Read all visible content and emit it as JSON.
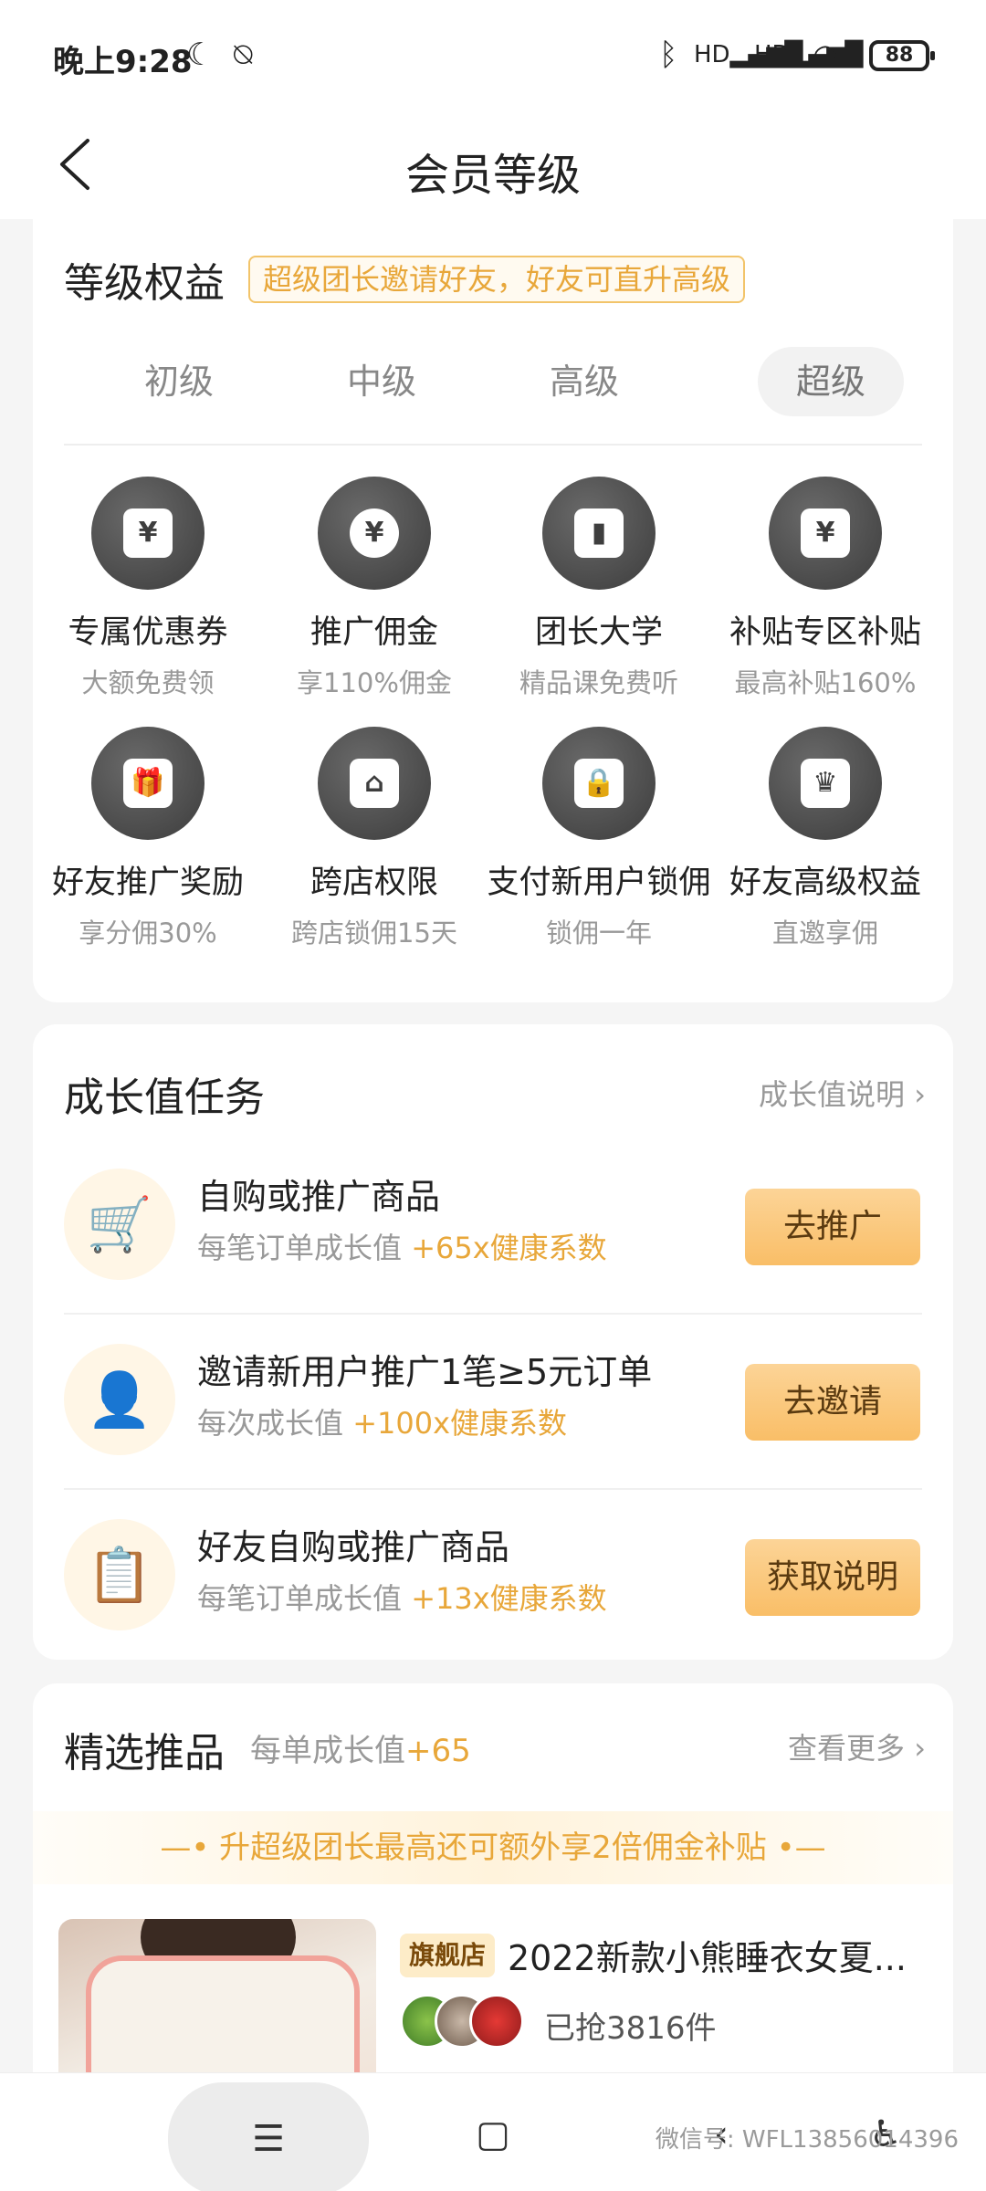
{
  "status_bar": {
    "time": "晚上9:28",
    "icons": [
      "moon-icon",
      "alarm-off-icon",
      "bluetooth-icon",
      "signal-hd-icon",
      "signal-hd-icon",
      "wifi-icon"
    ],
    "battery": "88"
  },
  "header": {
    "title": "会员等级",
    "back_icon": "chevron-left-icon"
  },
  "benefits_section": {
    "title": "等级权益",
    "promo": "超级团长邀请好友，好友可直升高级",
    "levels": [
      {
        "label": "初级",
        "active": false
      },
      {
        "label": "中级",
        "active": false
      },
      {
        "label": "高级",
        "active": false
      },
      {
        "label": "超级",
        "active": true
      }
    ],
    "items": [
      {
        "name": "专属优惠券",
        "sub": "大额免费领",
        "icon": "coupon-icon",
        "glyph": "¥"
      },
      {
        "name": "推广佣金",
        "sub": "享110%佣金",
        "icon": "yen-coin-icon",
        "glyph": "¥"
      },
      {
        "name": "团长大学",
        "sub": "精品课免费听",
        "icon": "book-icon",
        "glyph": "▮"
      },
      {
        "name": "补贴专区补贴",
        "sub": "最高补贴160%",
        "icon": "yen-envelope-icon",
        "glyph": "¥"
      },
      {
        "name": "好友推广奖励",
        "sub": "享分佣30%",
        "icon": "gift-icon",
        "glyph": "🎁"
      },
      {
        "name": "跨店权限",
        "sub": "跨店锁佣15天",
        "icon": "store-icon",
        "glyph": "⌂"
      },
      {
        "name": "支付新用户锁佣",
        "sub": "锁佣一年",
        "icon": "lock-icon",
        "glyph": "🔒"
      },
      {
        "name": "好友高级权益",
        "sub": "直邀享佣",
        "icon": "crown-icon",
        "glyph": "♛"
      }
    ]
  },
  "tasks_section": {
    "title": "成长值任务",
    "more": "成长值说明",
    "tasks": [
      {
        "title": "自购或推广商品",
        "sub_prefix": "每笔订单成长值 ",
        "sub_highlight": "+65x健康系数",
        "button": "去推广",
        "icon": "cart-icon"
      },
      {
        "title": "邀请新用户推广1笔≥5元订单",
        "sub_prefix": "每次成长值 ",
        "sub_highlight": "+100x健康系数",
        "button": "去邀请",
        "icon": "user-icon"
      },
      {
        "title": "好友自购或推广商品",
        "sub_prefix": "每笔订单成长值 ",
        "sub_highlight": "+13x健康系数",
        "button": "获取说明",
        "icon": "clipboard-check-icon"
      }
    ]
  },
  "featured_section": {
    "title": "精选推品",
    "sub_prefix": "每单成长值",
    "sub_highlight": "+65",
    "more": "查看更多",
    "banner": "—• 升超级团长最高还可额外享2倍佣金补贴 •—",
    "product": {
      "badge": "旗舰店",
      "title": "2022新款小熊睡衣女夏...",
      "sold": "已抢3816件"
    }
  },
  "nav_bar": {
    "menu_icon": "menu-icon",
    "home_icon": "square-home-icon",
    "back_icon": "back-triangle-icon",
    "accessibility_icon": "accessibility-icon",
    "watermark": "微信号: WFL13856014396"
  },
  "colors": {
    "accent": "#e8a73a",
    "button": "#f9be67",
    "icon_dark": "#3c3c3c"
  }
}
